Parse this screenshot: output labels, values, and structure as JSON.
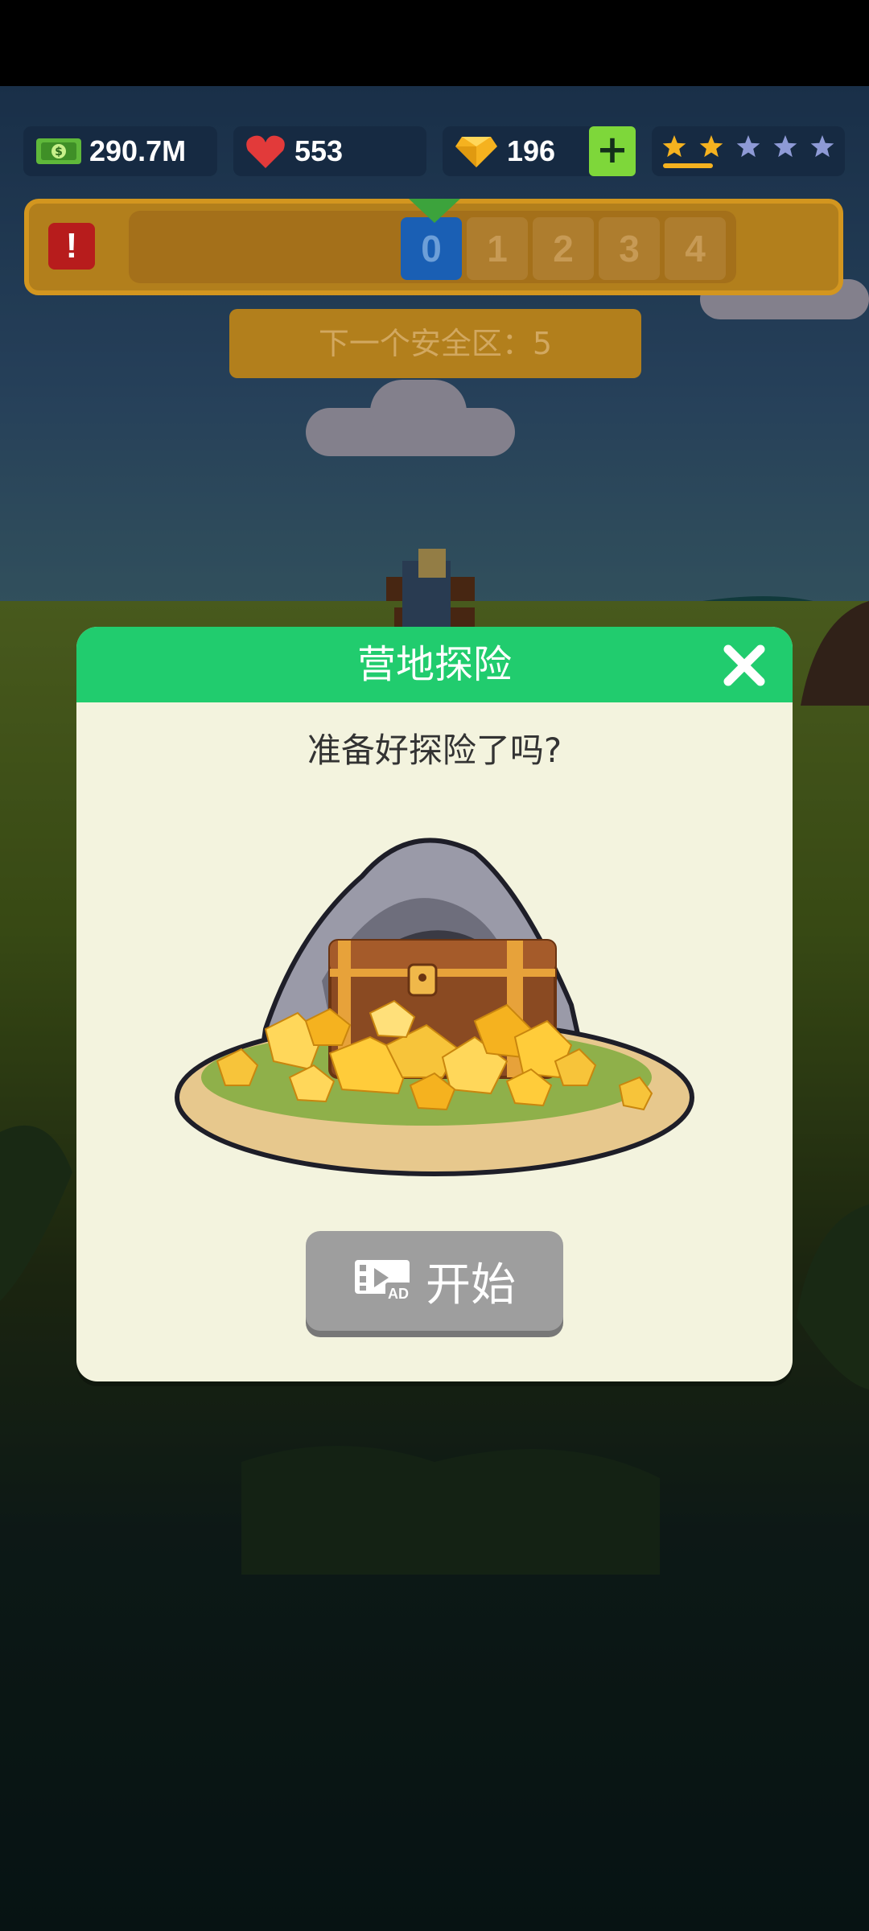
{
  "hud": {
    "cash": "290.7M",
    "hearts": "553",
    "gems": "196",
    "plus_label": "+",
    "stars_filled": 2,
    "stars_total": 5
  },
  "level_bar": {
    "alert_label": "!",
    "levels": [
      "0",
      "1",
      "2",
      "3",
      "4"
    ],
    "current_level": "0"
  },
  "safe_zone": {
    "label": "下一个安全区：5"
  },
  "dialog": {
    "title": "营地探险",
    "question": "准备好探险了吗?",
    "start_label": "开始",
    "ad_icon": "video-ad-icon"
  },
  "colors": {
    "header_green": "#21cc6e",
    "dialog_bg": "#f3f3de",
    "level_gold": "#b27f1c",
    "level_active": "#1a5fb4",
    "hud_bg": "#162a42",
    "plus_green": "#7ed73a"
  }
}
